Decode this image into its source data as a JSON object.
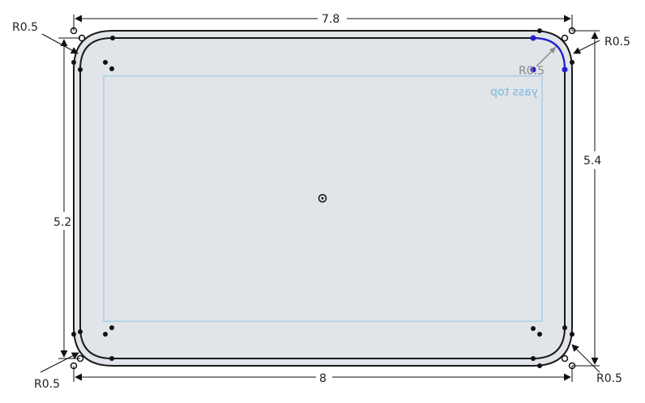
{
  "dimensions": {
    "top_width": "7.8",
    "bottom_width": "8",
    "left_height": "5.2",
    "right_height": "5.4",
    "radius_top_left": "R0.5",
    "radius_top_right": "R0.5",
    "radius_bottom_left": "R0.5",
    "radius_bottom_right": "R0.5",
    "radius_inner_active": "R0.5"
  },
  "plane_label": "yass top",
  "colors": {
    "fill": "#e1e4e8",
    "stroke": "#1a1a1a",
    "plane": "#8ec5ea",
    "active_arc": "#1f1fd0",
    "dimension": "#222222"
  }
}
